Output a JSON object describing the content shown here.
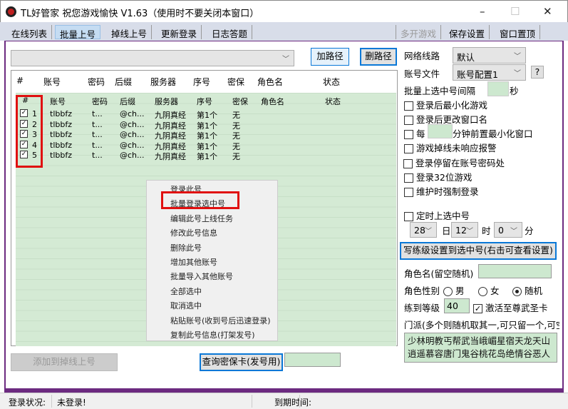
{
  "window": {
    "title": "TL好管家 祝您游戏愉快 V1.63（使用时不要关闭本窗口）",
    "minimize": "–",
    "maximize": "☐",
    "close": "✕"
  },
  "menu": {
    "left": [
      "在线列表",
      "批量上号",
      "掉线上号",
      "更新登录",
      "日志答题"
    ],
    "right": [
      "多开游戏",
      "保存设置",
      "窗口置顶"
    ],
    "active": "批量上号"
  },
  "path": {
    "combo_value": "",
    "add_label": "加路径",
    "del_label": "删路径"
  },
  "table": {
    "columns": [
      "#",
      "账号",
      "密码",
      "后缀",
      "服务器",
      "序号",
      "密保",
      "角色名",
      "状态"
    ],
    "rows": [
      {
        "checked": true,
        "num": "1",
        "account": "tlbbfz",
        "password": "t...",
        "suffix": "@ch...",
        "server": "九阴真经",
        "seq": "第1个",
        "mibao": "无",
        "role": "",
        "status": ""
      },
      {
        "checked": true,
        "num": "2",
        "account": "tlbbfz",
        "password": "t...",
        "suffix": "@ch...",
        "server": "九阴真经",
        "seq": "第1个",
        "mibao": "无",
        "role": "",
        "status": ""
      },
      {
        "checked": true,
        "num": "3",
        "account": "tlbbfz",
        "password": "t...",
        "suffix": "@ch...",
        "server": "九阴真经",
        "seq": "第1个",
        "mibao": "无",
        "role": "",
        "status": ""
      },
      {
        "checked": true,
        "num": "4",
        "account": "tlbbfz",
        "password": "t...",
        "suffix": "@ch...",
        "server": "九阴真经",
        "seq": "第1个",
        "mibao": "无",
        "role": "",
        "status": ""
      },
      {
        "checked": true,
        "num": "5",
        "account": "tlbbfz",
        "password": "t...",
        "suffix": "@ch...",
        "server": "九阴真经",
        "seq": "第1个",
        "mibao": "无",
        "role": "",
        "status": ""
      }
    ]
  },
  "context_menu": [
    "登录此号",
    "批量登录选中号",
    "编辑此号上线任务",
    "修改此号信息",
    "删除此号",
    "增加其他账号",
    "批量导入其他账号",
    "全部选中",
    "取消选中",
    "粘贴账号(收到号后迅速登录)",
    "复制此号信息(打架发号)"
  ],
  "bottom": {
    "add_offline_label": "添加到掉线上号",
    "query_label": "查询密保卡(发号用)",
    "query_value": ""
  },
  "settings": {
    "network_label": "网络线路",
    "network_value": "默认",
    "account_file_label": "账号文件",
    "account_file_value": "账号配置1",
    "help_label": "?",
    "interval_label": "批量上选中号间隔",
    "interval_value": "",
    "interval_unit": "秒",
    "options": [
      {
        "label": "登录后最小化游戏",
        "checked": false
      },
      {
        "label": "登录后更改窗口名",
        "checked": false
      },
      {
        "label": "游戏掉线未响应报警",
        "checked": false
      },
      {
        "label": "登录停留在账号密码处",
        "checked": false
      },
      {
        "label": "登录32位游戏",
        "checked": false
      },
      {
        "label": "维护时强制登录",
        "checked": false
      }
    ],
    "every_prefix": "每",
    "every_value": "",
    "every_suffix": "分钟前置最小化窗口",
    "timed_label": "定时上选中号",
    "day": "28",
    "day_unit": "日",
    "hour": "12",
    "hour_unit": "时",
    "minute": "0",
    "minute_unit": "分",
    "write_button": "写练级设置到选中号(右击可查看设置)",
    "role_name_label": "角色名(留空随机)",
    "role_name_value": "",
    "gender_label": "角色性别",
    "gender_options": [
      "男",
      "女",
      "随机"
    ],
    "gender_selected": "随机",
    "level_label": "练到等级",
    "level_value": "40",
    "activate_label": "激活至尊武圣卡",
    "activate_checked": true,
    "sect_label": "门派(多个则随机取其一,可只留一个,可空",
    "sect_value": "少林明教丐帮武当峨嵋星宿天龙天山逍遥慕容唐门鬼谷桃花岛绝情谷恶人谷"
  },
  "status": {
    "login_label": "登录状况:",
    "login_value": "未登录!",
    "expire_label": "到期时间:",
    "expire_value": ""
  }
}
